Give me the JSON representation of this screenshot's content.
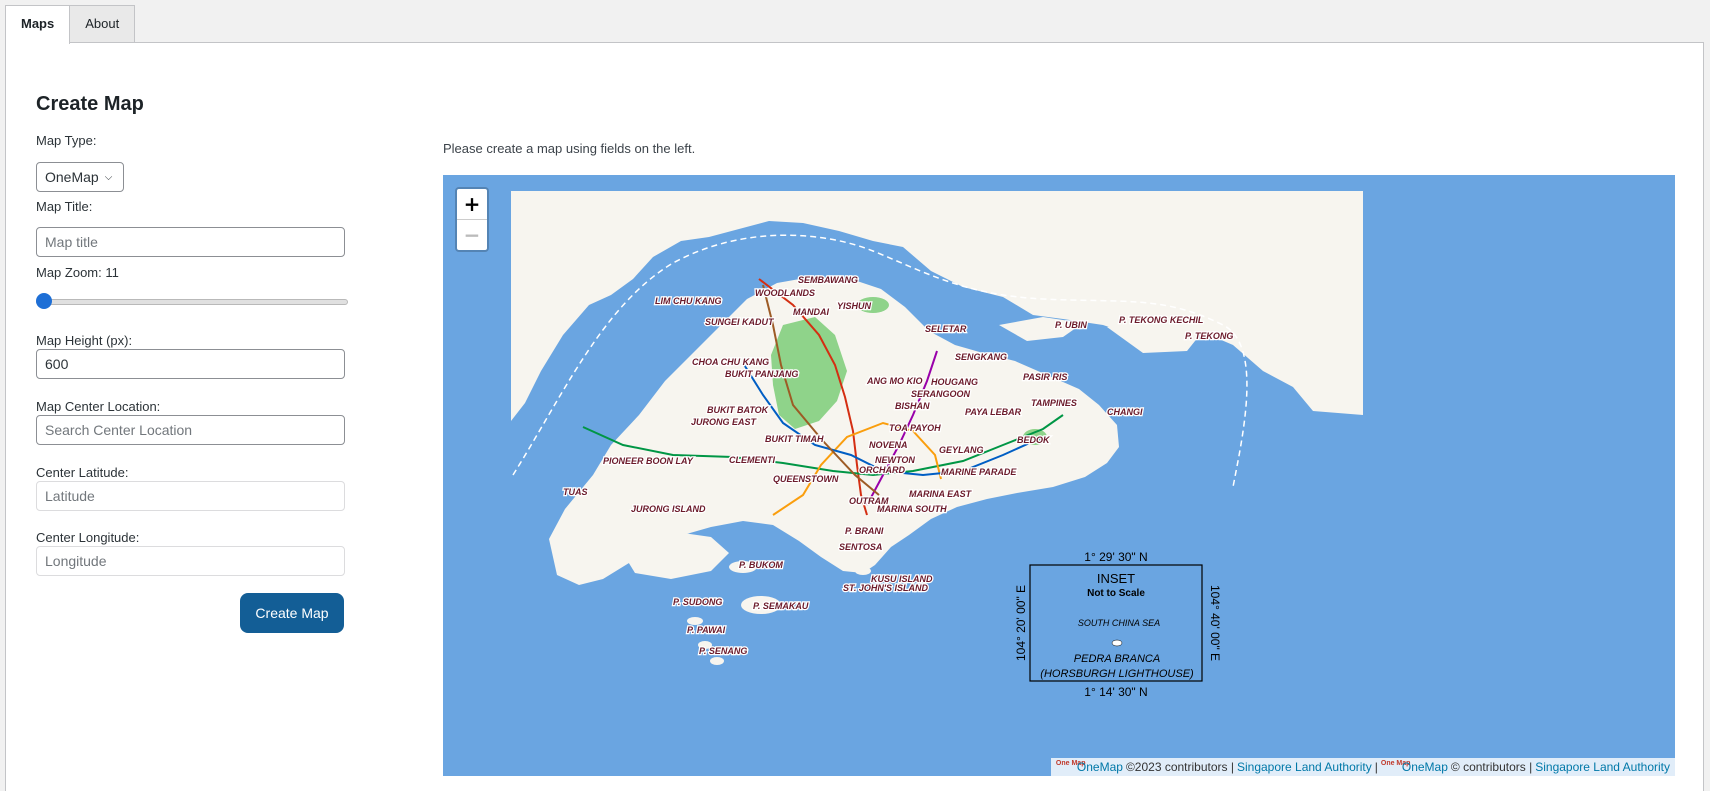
{
  "tabs": [
    {
      "label": "Maps",
      "active": true
    },
    {
      "label": "About",
      "active": false
    }
  ],
  "page": {
    "title": "Create Map"
  },
  "form": {
    "map_type": {
      "label": "Map Type:",
      "value": "OneMap"
    },
    "map_title": {
      "label": "Map Title:",
      "placeholder": "Map title"
    },
    "zoom": {
      "label": "Map Zoom: 11",
      "value": 11
    },
    "height": {
      "label": "Map Height (px):",
      "value": "600"
    },
    "center_location": {
      "label": "Map Center Location:",
      "placeholder": "Search Center Location"
    },
    "latitude": {
      "label": "Center Latitude:",
      "placeholder": "Latitude"
    },
    "longitude": {
      "label": "Center Longitude:",
      "placeholder": "Longitude"
    },
    "submit_label": "Create Map"
  },
  "main": {
    "hint": "Please create a map using fields on the left."
  },
  "map": {
    "zoom_in": "+",
    "zoom_out": "−",
    "colors": {
      "sea": "#6aa5e1",
      "land": "#f7f5ef",
      "park": "#8fd38a",
      "accent": "#135e96"
    },
    "place_labels": [
      "SEMBAWANG",
      "WOODLANDS",
      "MANDAI",
      "YISHUN",
      "LIM CHU KANG",
      "SUNGEI KADUT",
      "SELETAR",
      "P. UBIN",
      "P. TEKONG KECHIL",
      "P. TEKONG",
      "SENGKANG",
      "CHOA CHU KANG",
      "BUKIT PANJANG",
      "ANG MO KIO",
      "HOUGANG",
      "PASIR RIS",
      "SERANGOON",
      "BISHAN",
      "TAMPINES",
      "BUKIT BATOK",
      "PAYA LEBAR",
      "CHANGI",
      "JURONG EAST",
      "TOA PAYOH",
      "BUKIT TIMAH",
      "NOVENA",
      "BEDOK",
      "GEYLANG",
      "PIONEER BOON LAY",
      "CLEMENTI",
      "NEWTON",
      "ORCHARD",
      "MARINE PARADE",
      "QUEENSTOWN",
      "MARINA EAST",
      "TUAS",
      "OUTRAM",
      "JURONG ISLAND",
      "MARINA SOUTH",
      "P. BRANI",
      "SENTOSA",
      "P. BUKOM",
      "KUSU ISLAND",
      "ST. JOHN'S ISLAND",
      "P. SUDONG",
      "P. SEMAKAU",
      "P. PAWAI",
      "P. SENANG"
    ],
    "inset": {
      "top": "1° 29' 30\" N",
      "bottom": "1° 14' 30\" N",
      "left": "104° 20' 00\" E",
      "right": "104° 40' 00\" E",
      "title": "INSET",
      "subtitle": "Not to Scale",
      "sea": "SOUTH CHINA SEA",
      "feature1": "PEDRA BRANCA",
      "feature2": "(HORSBURGH LIGHTHOUSE)"
    },
    "attribution": {
      "logo": "One Map",
      "link1": "OneMap",
      "text1": "©2023 contributors |",
      "link2": "Singapore Land Authority",
      "sep": "|",
      "link3": "OneMap",
      "text2": "© contributors |",
      "link4": "Singapore Land Authority"
    }
  }
}
